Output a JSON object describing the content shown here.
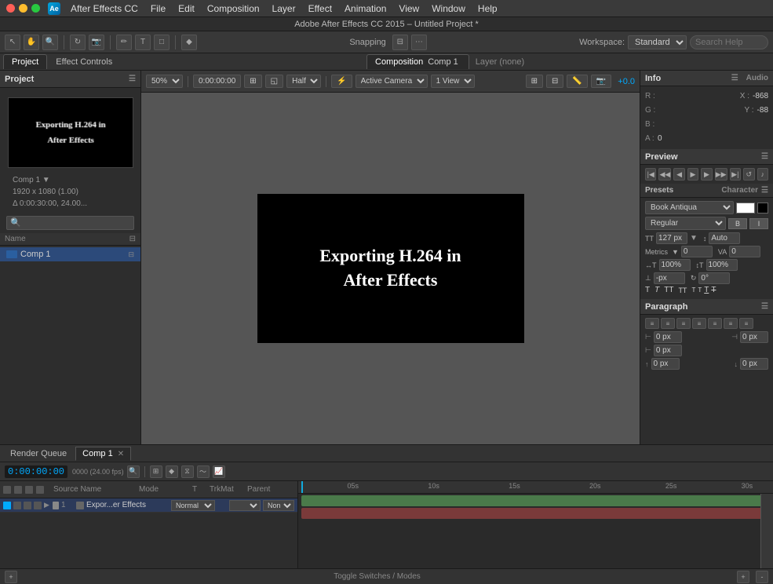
{
  "app": {
    "title": "Adobe After Effects CC 2015 – Untitled Project *",
    "ae_label": "Ae"
  },
  "menubar": {
    "items": [
      "After Effects CC",
      "File",
      "Edit",
      "Composition",
      "Layer",
      "Effect",
      "Animation",
      "View",
      "Window",
      "Help"
    ]
  },
  "toolbar": {
    "snapping_label": "Snapping",
    "workspace_label": "Workspace:",
    "workspace_value": "Standard",
    "search_placeholder": "Search Help"
  },
  "panel_tabs": {
    "project_label": "Project",
    "effect_controls_label": "Effect Controls",
    "comp_tab_label": "Composition",
    "comp_name": "Comp 1",
    "layer_label": "Layer (none)"
  },
  "project": {
    "comp_name": "Comp 1 ▼",
    "comp_info_line1": "1920 x 1080 (1.00)",
    "comp_info_line2": "Δ 0:00:30:00, 24.00...",
    "name_column": "Name",
    "comp_item": "Comp 1"
  },
  "composition": {
    "zoom_label": "50%",
    "time_label": "0:00:00:00",
    "quality_label": "Half",
    "camera_label": "Active Camera",
    "view_label": "1 View",
    "offset_label": "+0.0",
    "canvas_text_line1": "Exporting H.264 in",
    "canvas_text_line2": "After Effects"
  },
  "info_panel": {
    "header": "Info",
    "audio_label": "Audio",
    "r_label": "R :",
    "g_label": "G :",
    "b_label": "B :",
    "a_label": "A :",
    "r_value": "",
    "g_value": "",
    "b_value": "",
    "a_value": "0",
    "x_label": "X :",
    "x_value": "-868",
    "y_label": "Y :",
    "y_value": "-88"
  },
  "preview_panel": {
    "header": "Preview"
  },
  "character_panel": {
    "header": "Character",
    "presets_label": "Presets",
    "font_name": "Book Antiqua",
    "font_style": "Regular",
    "size_value": "127 px",
    "tracking_label": "Metrics",
    "tracking_value": "0",
    "size_unit": "px",
    "leading_label": "Auto",
    "leading_value": "Auto",
    "kerning_label": "VA",
    "tsumi_label": "VA",
    "scale_h_value": "100%",
    "scale_v_value": "100%",
    "baseline_value": "0°",
    "bold_label": "T",
    "italic_label": "T",
    "caps_label": "TT",
    "small_caps_label": "TT",
    "super_label": "T",
    "sub_label": "T",
    "underline_label": "T",
    "strike_label": "T̶"
  },
  "paragraph_panel": {
    "header": "Paragraph",
    "indent_l_value": "0 px",
    "indent_r_value": "0 px",
    "indent_f_value": "0 px",
    "space_before_value": "0 px",
    "space_after_value": "0 px"
  },
  "timeline": {
    "render_queue_label": "Render Queue",
    "comp_tab_label": "Comp 1",
    "time_display": "0:00:00:00",
    "fps_label": "0000 (24.00 fps)",
    "col_source_name": "Source Name",
    "col_mode": "Mode",
    "col_t": "T",
    "col_trkmat": "TrkMat",
    "col_parent": "Parent",
    "layer_num": "1",
    "layer_name": "Expor...er Effects",
    "layer_mode": "Normal",
    "layer_parent_none": "None",
    "bottom_label": "Toggle Switches / Modes",
    "time_markers": [
      "05s",
      "10s",
      "15s",
      "20s",
      "25s",
      "30s"
    ]
  }
}
